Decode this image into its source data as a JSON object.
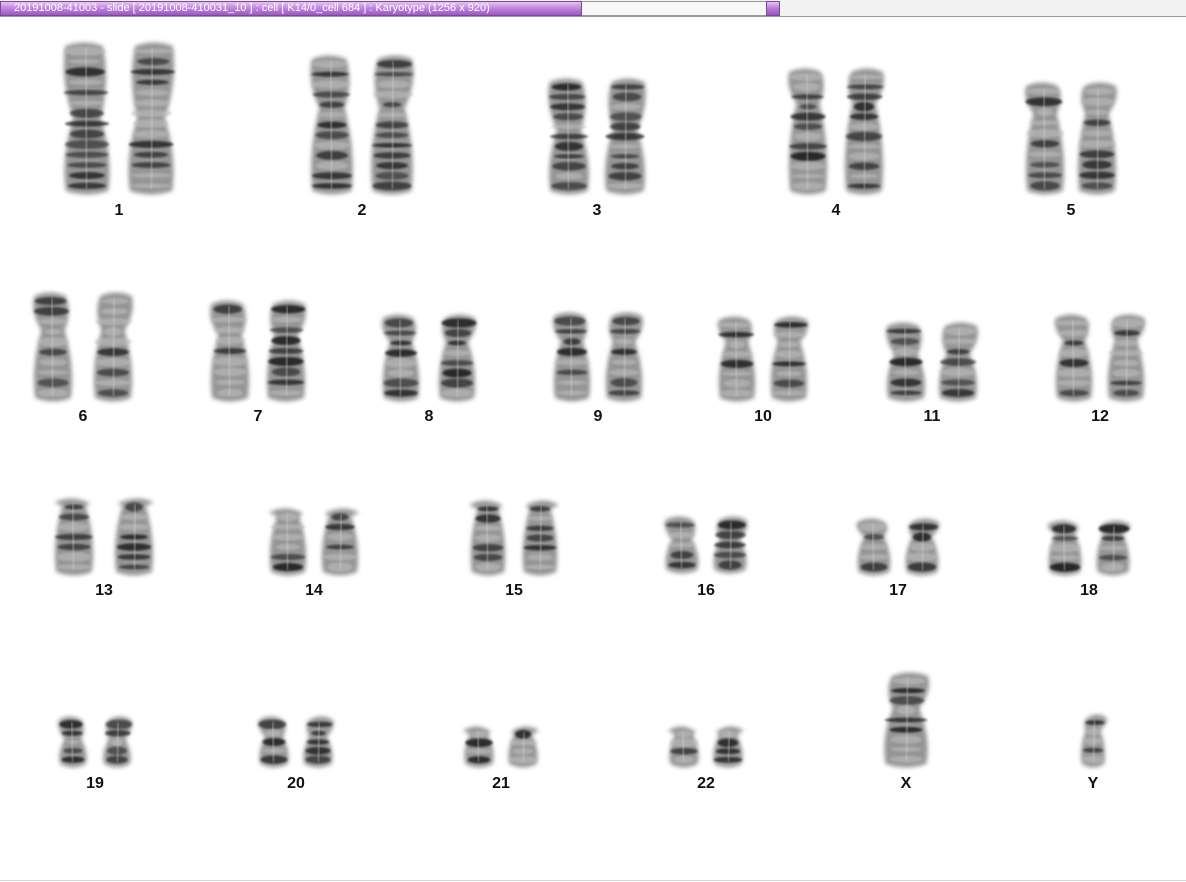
{
  "window": {
    "title": "20191008-41003 - slide [  20191008-410031_10 ] : cell [ K14/0_cell 684 ] : Karyotype  (1256 x 920)"
  },
  "karyotype": {
    "chromosomes": [
      {
        "label": "1"
      },
      {
        "label": "2"
      },
      {
        "label": "3"
      },
      {
        "label": "4"
      },
      {
        "label": "5"
      },
      {
        "label": "6"
      },
      {
        "label": "7"
      },
      {
        "label": "8"
      },
      {
        "label": "9"
      },
      {
        "label": "10"
      },
      {
        "label": "11"
      },
      {
        "label": "12"
      },
      {
        "label": "13"
      },
      {
        "label": "14"
      },
      {
        "label": "15"
      },
      {
        "label": "16"
      },
      {
        "label": "17"
      },
      {
        "label": "18"
      },
      {
        "label": "19"
      },
      {
        "label": "20"
      },
      {
        "label": "21"
      },
      {
        "label": "22"
      },
      {
        "label": "X"
      },
      {
        "label": "Y"
      }
    ]
  }
}
